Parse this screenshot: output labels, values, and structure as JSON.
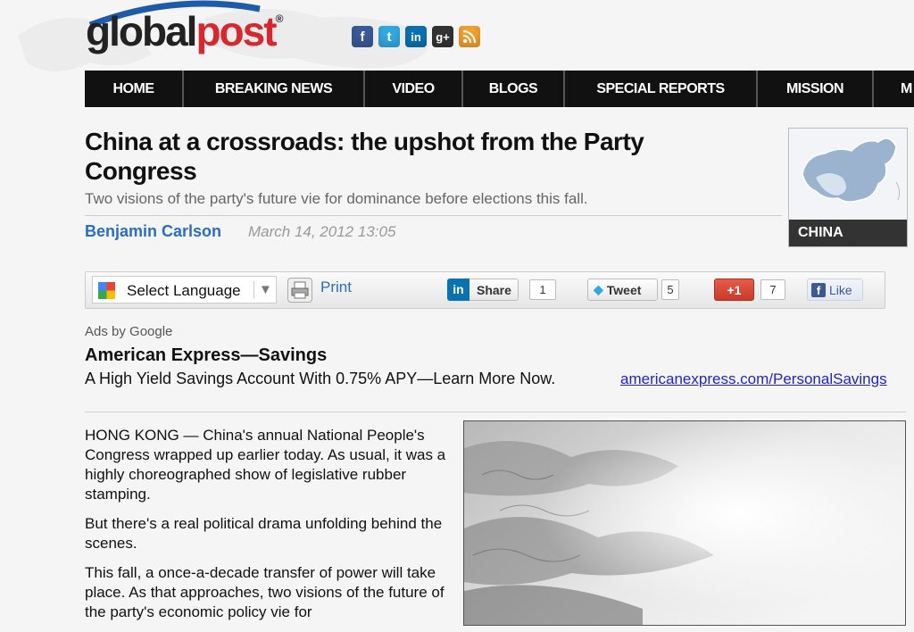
{
  "logo": {
    "part1": "global",
    "part2": "post",
    "registered": "®"
  },
  "social": [
    {
      "name": "facebook-icon",
      "glyph": "f",
      "color": "#3b5998"
    },
    {
      "name": "twitter-icon",
      "glyph": "t",
      "color": "#33a8e0"
    },
    {
      "name": "linkedin-icon",
      "glyph": "in",
      "color": "#0a72b0"
    },
    {
      "name": "google-plus-icon",
      "glyph": "g+",
      "color": "#333333"
    },
    {
      "name": "rss-icon",
      "glyph": ")",
      "color": "#f0a030"
    }
  ],
  "nav": [
    "HOME",
    "BREAKING NEWS",
    "VIDEO",
    "BLOGS",
    "SPECIAL REPORTS",
    "MISSION",
    "M"
  ],
  "article": {
    "headline": "China at a crossroads: the upshot from the Party Congress",
    "subhead": "Two visions of the party's future vie for dominance before elections this fall.",
    "author": "Benjamin Carlson",
    "date": "March 14, 2012 13:05",
    "paragraphs": [
      "HONG KONG — China's annual National People's Congress wrapped up earlier today. As usual, it was a highly choreographed show of legislative rubber stamping.",
      "But there's a real political drama unfolding behind the scenes.",
      "This fall, a once-a-decade transfer of power will take place. As that approaches, two visions of the future of the party's economic policy vie for"
    ]
  },
  "region_box": {
    "label": "CHINA"
  },
  "sharebar": {
    "language": "Select Language",
    "arrow": "▼",
    "print": "Print",
    "linkedin_label": "Share",
    "linkedin_count": "1",
    "tweet_label": "Tweet",
    "tweet_count": "5",
    "gplus_label": "+1",
    "gplus_count": "7",
    "like_label": "Like"
  },
  "ad": {
    "label": "Ads by Google",
    "title": "American Express—Savings",
    "description": "A High Yield Savings Account With 0.75% APY—Learn More Now.",
    "link": "americanexpress.com/PersonalSavings"
  },
  "colors": {
    "accent": "#d8272e",
    "nav_bg": "#111111",
    "link": "#2a6cc4"
  }
}
